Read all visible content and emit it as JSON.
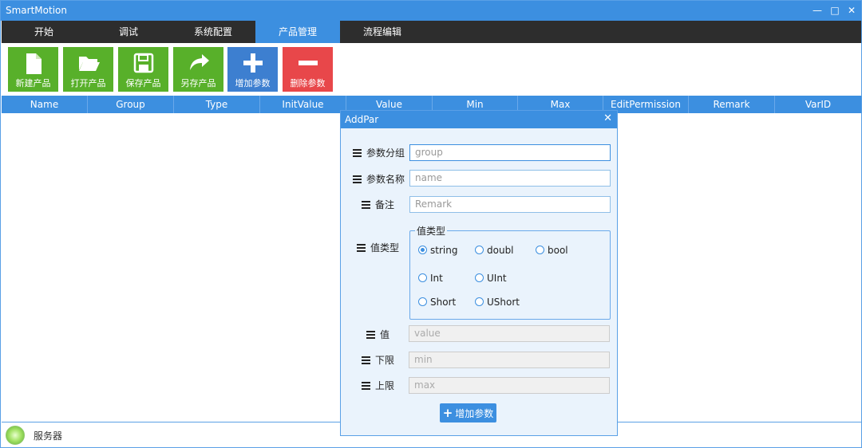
{
  "window": {
    "title": "SmartMotion",
    "minimize": "—",
    "maximize": "□",
    "close": "✕"
  },
  "menu": {
    "tabs": [
      "开始",
      "调试",
      "系统配置",
      "产品管理",
      "流程编辑"
    ],
    "active_index": 3
  },
  "toolbar": {
    "buttons": [
      {
        "label": "新建产品",
        "icon": "new-file-icon",
        "color": "#58b02a"
      },
      {
        "label": "打开产品",
        "icon": "folder-open-icon",
        "color": "#58b02a"
      },
      {
        "label": "保存产品",
        "icon": "save-icon",
        "color": "#58b02a"
      },
      {
        "label": "另存产品",
        "icon": "share-arrow-icon",
        "color": "#58b02a"
      },
      {
        "label": "增加参数",
        "icon": "plus-icon",
        "color": "#3d7fd0"
      },
      {
        "label": "删除参数",
        "icon": "minus-icon",
        "color": "#e8474a"
      }
    ]
  },
  "grid": {
    "columns": [
      "Name",
      "Group",
      "Type",
      "InitValue",
      "Value",
      "Min",
      "Max",
      "EditPermission",
      "Remark",
      "VarID"
    ]
  },
  "status": {
    "label": "服务器"
  },
  "dialog": {
    "title": "AddPar",
    "close": "✕",
    "fields": {
      "group": {
        "label": "参数分组",
        "placeholder": "group"
      },
      "name": {
        "label": "参数名称",
        "placeholder": "name"
      },
      "remark": {
        "label": "备注",
        "placeholder": "Remark"
      },
      "value_type": {
        "label": "值类型",
        "group_title": "值类型"
      },
      "value": {
        "label": "值",
        "placeholder": "value"
      },
      "min": {
        "label": "下限",
        "placeholder": "min"
      },
      "max": {
        "label": "上限",
        "placeholder": "max"
      }
    },
    "types": {
      "string": "string",
      "doubl": "doubl",
      "bool": "bool",
      "int": "Int",
      "uint": "UInt",
      "short": "Short",
      "ushort": "UShort",
      "selected": "string"
    },
    "add_button": "增加参数"
  },
  "colors": {
    "accent": "#3c8fe0",
    "menubar": "#2d2d2d",
    "dialog_bg": "#eaf3fc"
  }
}
